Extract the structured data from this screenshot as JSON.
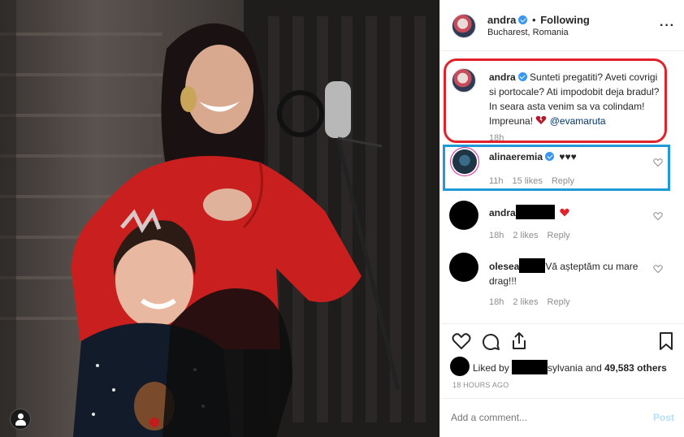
{
  "header": {
    "username": "andra",
    "follow_status": "Following",
    "location": "Bucharest, Romania",
    "more_icon": "more-options-icon"
  },
  "caption": {
    "username": "andra",
    "text": "Sunteti pregatiti? Aveti covrigi si portocale? Ati impodobit deja bradul? In seara asta venim sa va colindam! Impreuna!",
    "emoji": "broken-heart-emoji",
    "mention": "@evamaruta",
    "time": "18h"
  },
  "comments": [
    {
      "username": "alinaeremia",
      "text": "♥♥♥",
      "time": "11h",
      "likes": "15 likes",
      "reply": "Reply",
      "verified": true
    },
    {
      "username": "andra",
      "text": "",
      "emoji": "red-heart-emoji",
      "time": "18h",
      "likes": "2 likes",
      "reply": "Reply",
      "redacted": true
    },
    {
      "username": "olesea",
      "text": "Vă așteptăm cu mare drag!!!",
      "time": "18h",
      "likes": "2 likes",
      "reply": "Reply",
      "redacted": true
    }
  ],
  "actions": {
    "like_icon": "heart-outline-icon",
    "comment_icon": "comment-bubble-icon",
    "share_icon": "share-upload-icon",
    "save_icon": "bookmark-icon"
  },
  "likes": {
    "prefix": "Liked by",
    "name_suffix": "sylvania",
    "and": "and",
    "others": "49,583 others"
  },
  "timestamp": "18 HOURS AGO",
  "comment_input": {
    "placeholder": "Add a comment...",
    "post_label": "Post"
  },
  "colors": {
    "verified": "#3897f0",
    "highlight_red": "#e0232b",
    "highlight_blue": "#1e9ad6",
    "post_disabled": "#b2dffc"
  }
}
